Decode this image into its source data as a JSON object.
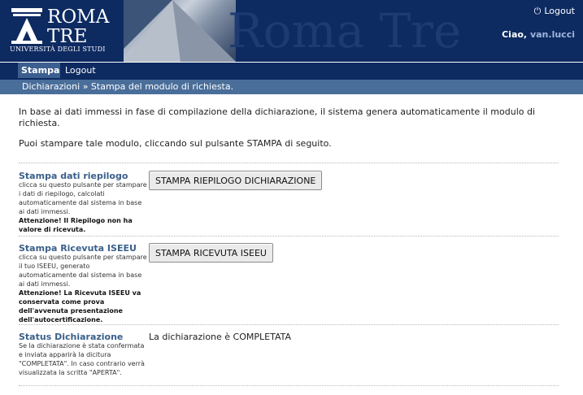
{
  "header": {
    "logo": {
      "line1": "ROMA",
      "line2": "TRE",
      "line3": "UNIVERSITÀ DEGLI STUDI"
    },
    "watermark": "Roma Tre",
    "logout_label": "Logout",
    "greeting": "Ciao,",
    "username": "van.lucci"
  },
  "nav": {
    "active_label": "Stampa",
    "logout_label": "Logout"
  },
  "breadcrumb": "Dichiarazioni » Stampa del modulo di richiesta.",
  "intro": {
    "p1": "In base ai dati immessi in fase di compilazione della dichiarazione, il sistema genera automaticamente il modulo di richiesta.",
    "p2": "Puoi stampare tale modulo, cliccando sul pulsante STAMPA di seguito."
  },
  "sections": {
    "riepilogo": {
      "title": "Stampa dati riepilogo",
      "desc": "clicca su questo pulsante per stampare i dati di riepilogo, calcolati automaticamente dal sistema in base ai dati immessi.",
      "warning": "Attenzione! Il Riepilogo non ha valore di ricevuta.",
      "button": "STAMPA RIEPILOGO DICHIARAZIONE"
    },
    "ricevuta": {
      "title": "Stampa Ricevuta ISEEU",
      "desc": "clicca su questo pulsante per stampare il tuo ISEEU, generato automaticamente dal sistema in base ai dati immessi.",
      "warning": "Attenzione! La Ricevuta ISEEU va conservata come prova dell'avvenuta presentazione dell'autocertificazione.",
      "button": "STAMPA RICEVUTA ISEEU"
    },
    "status": {
      "title": "Status Dichiarazione",
      "desc": "Se la dichiarazione è stata confermata e inviata apparirà la dicitura \"COMPLETATA\". In caso contrario verrà visualizzata la scritta \"APERTA\".",
      "value": "La dichiarazione è COMPLETATA"
    }
  }
}
